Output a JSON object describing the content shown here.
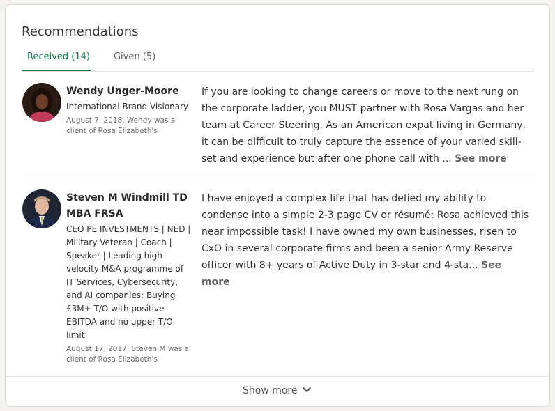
{
  "section": {
    "title": "Recommendations"
  },
  "tabs": [
    {
      "label": "Received (14)",
      "active": true
    },
    {
      "label": "Given (5)",
      "active": false
    }
  ],
  "recommendations": [
    {
      "name": "Wendy Unger-Moore",
      "headline": "International Brand Visionary",
      "meta": "August 7, 2018, Wendy was a client of Rosa Elizabeth's",
      "text": "If you are looking to change careers or move to the next rung on the corporate ladder, you MUST partner with Rosa Vargas and her team at Career Steering. As an American expat living in Germany, it can be difficult to truly capture the essence of your varied skill-set and experience but after one phone call with ...",
      "see_more": "See more"
    },
    {
      "name": "Steven M Windmill TD MBA FRSA",
      "headline": "CEO PE INVESTMENTS | NED | Military Veteran | Coach | Speaker | Leading high-velocity M&A programme of IT Services, Cybersecurity, and AI companies: Buying £3M+ T/O with positive EBITDA and no upper T/O limit",
      "meta": "August 17, 2017, Steven M was a client of Rosa Elizabeth's",
      "text": "I have enjoyed a complex life that has defied my ability to condense into a simple 2-3 page CV or résumé: Rosa achieved this near impossible task! I have owned my own businesses, risen to CxO in several corporate firms and been a senior Army Reserve officer with 8+ years of Active Duty in 3-star and 4-sta...",
      "see_more": "See more"
    }
  ],
  "footer": {
    "show_more": "Show more",
    "icon": "chevron-down-icon"
  },
  "colors": {
    "accent": "#0a7a46",
    "text": "#333333",
    "muted": "#666666"
  }
}
